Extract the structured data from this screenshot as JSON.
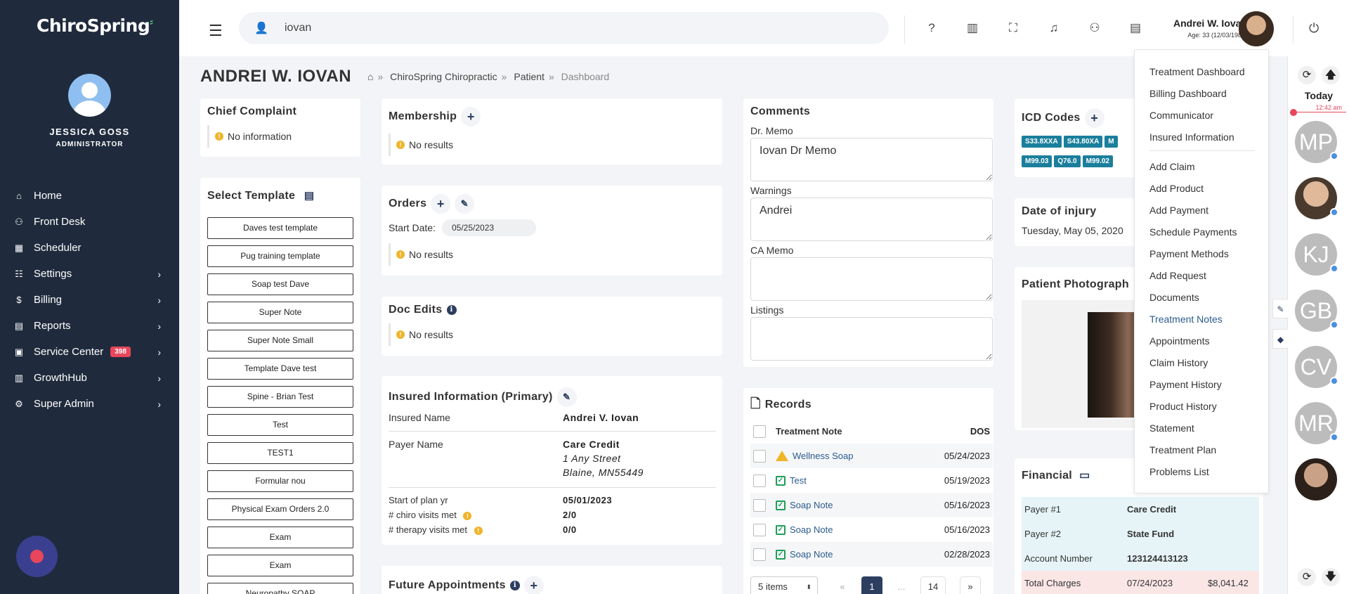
{
  "app": {
    "logo": "ChiroSpring"
  },
  "sidebar": {
    "user_name": "JESSICA GOSS",
    "user_role": "ADMINISTRATOR",
    "items": [
      {
        "label": "Home",
        "icon": "home-icon",
        "glyph": "⌂",
        "chevron": false
      },
      {
        "label": "Front Desk",
        "icon": "front-desk-icon",
        "glyph": "⚇",
        "chevron": false
      },
      {
        "label": "Scheduler",
        "icon": "calendar-icon",
        "glyph": "▦",
        "chevron": false
      },
      {
        "label": "Settings",
        "icon": "sliders-icon",
        "glyph": "☷",
        "chevron": true
      },
      {
        "label": "Billing",
        "icon": "dollar-icon",
        "glyph": "$",
        "chevron": true
      },
      {
        "label": "Reports",
        "icon": "document-icon",
        "glyph": "▤",
        "chevron": true
      },
      {
        "label": "Service Center",
        "icon": "grid-icon",
        "glyph": "▣",
        "chevron": true,
        "badge": "398"
      },
      {
        "label": "GrowthHub",
        "icon": "chart-icon",
        "glyph": "▥",
        "chevron": true
      },
      {
        "label": "Super Admin",
        "icon": "gear-icon",
        "glyph": "⚙",
        "chevron": true
      }
    ]
  },
  "topbar": {
    "search_value": "iovan",
    "user_name": "Andrei W. Iovan",
    "user_age": "Age: 33 (12/03/1989)"
  },
  "page": {
    "title": "ANDREI W. IOVAN",
    "breadcrumb": [
      "ChiroSpring Chiropractic",
      "Patient",
      "Dashboard"
    ]
  },
  "chief_complaint": {
    "title": "Chief Complaint",
    "text": "No information"
  },
  "select_template": {
    "title": "Select Template",
    "items": [
      "Daves test template",
      "Pug training template",
      "Soap test Dave",
      "Super Note",
      "Super Note Small",
      "Template Dave test",
      "Spine - Brian Test",
      "Test",
      "TEST1",
      "Formular nou",
      "Physical Exam Orders 2.0",
      "Exam",
      "Exam",
      "Neuropathy SOAP"
    ]
  },
  "membership": {
    "title": "Membership",
    "text": "No results"
  },
  "orders": {
    "title": "Orders",
    "start_label": "Start Date:",
    "start_value": "05/25/2023",
    "text": "No results"
  },
  "doc_edits": {
    "title": "Doc Edits",
    "text": "No results"
  },
  "insured": {
    "title": "Insured Information (Primary)",
    "insured_name_label": "Insured Name",
    "insured_name": "Andrei V. Iovan",
    "payer_label": "Payer Name",
    "payer_name": "Care Credit",
    "payer_street": "1 Any Street",
    "payer_city": "Blaine, MN55449",
    "plan_label": "Start of plan yr",
    "plan_value": "05/01/2023",
    "chiro_label": "# chiro visits met",
    "chiro_value": "2/0",
    "therapy_label": "# therapy visits met",
    "therapy_value": "0/0"
  },
  "future_appts": {
    "title": "Future Appointments"
  },
  "comments": {
    "title": "Comments",
    "dr_memo_label": "Dr. Memo",
    "dr_memo": "Iovan Dr Memo",
    "warnings_label": "Warnings",
    "warnings": "Andrei",
    "ca_memo_label": "CA Memo",
    "ca_memo": "",
    "listings_label": "Listings",
    "listings": ""
  },
  "records": {
    "title": "Records",
    "col_note": "Treatment Note",
    "col_dos": "DOS",
    "rows": [
      {
        "name": "Wellness Soap",
        "date": "05/24/2023",
        "status": "warning"
      },
      {
        "name": "Test",
        "date": "05/19/2023",
        "status": "ok"
      },
      {
        "name": "Soap Note",
        "date": "05/16/2023",
        "status": "ok"
      },
      {
        "name": "Soap Note",
        "date": "05/16/2023",
        "status": "ok"
      },
      {
        "name": "Soap Note",
        "date": "02/28/2023",
        "status": "ok"
      }
    ],
    "page_size": "5 items",
    "prev": "«",
    "page": "1",
    "ellipsis": "...",
    "last": "14",
    "next": "»"
  },
  "icd": {
    "title": "ICD Codes",
    "codes_row1": [
      "S33.8XXA",
      "S43.80XA",
      "M"
    ],
    "codes_row2": [
      "M99.03",
      "Q76.0",
      "M99.02"
    ]
  },
  "injury": {
    "title": "Date of injury",
    "date": "Tuesday, May 05, 2020"
  },
  "photo": {
    "title": "Patient Photograph"
  },
  "financial": {
    "title": "Financial",
    "rows": [
      {
        "label": "Payer #1",
        "value": "Care Credit",
        "extra": ""
      },
      {
        "label": "Payer #2",
        "value": "State Fund",
        "extra": ""
      },
      {
        "label": "Account Number",
        "value": "123124413123",
        "extra": ""
      },
      {
        "label": "Total Charges",
        "value": "07/24/2023",
        "extra": "$8,041.42"
      }
    ]
  },
  "dropdown": {
    "group1": [
      "Treatment Dashboard",
      "Billing Dashboard",
      "Communicator",
      "Insured Information"
    ],
    "group2": [
      "Add Claim",
      "Add Product",
      "Add Payment",
      "Schedule Payments",
      "Payment Methods",
      "Add Request",
      "Documents",
      "Treatment Notes",
      "Appointments",
      "Claim History",
      "Payment History",
      "Product History",
      "Statement",
      "Treatment Plan",
      "Problems List"
    ],
    "active": "Treatment Notes"
  },
  "rail": {
    "today": "Today",
    "time": "12:42 am",
    "avatars": [
      "MP",
      "",
      "KJ",
      "GB",
      "CV",
      "MR",
      ""
    ]
  },
  "colors": {
    "sidebar": "#1f2b3d",
    "accent": "#2d3e60",
    "badge": "#e8465b",
    "icd": "#1a7f9c",
    "link": "#2c5b8c"
  }
}
